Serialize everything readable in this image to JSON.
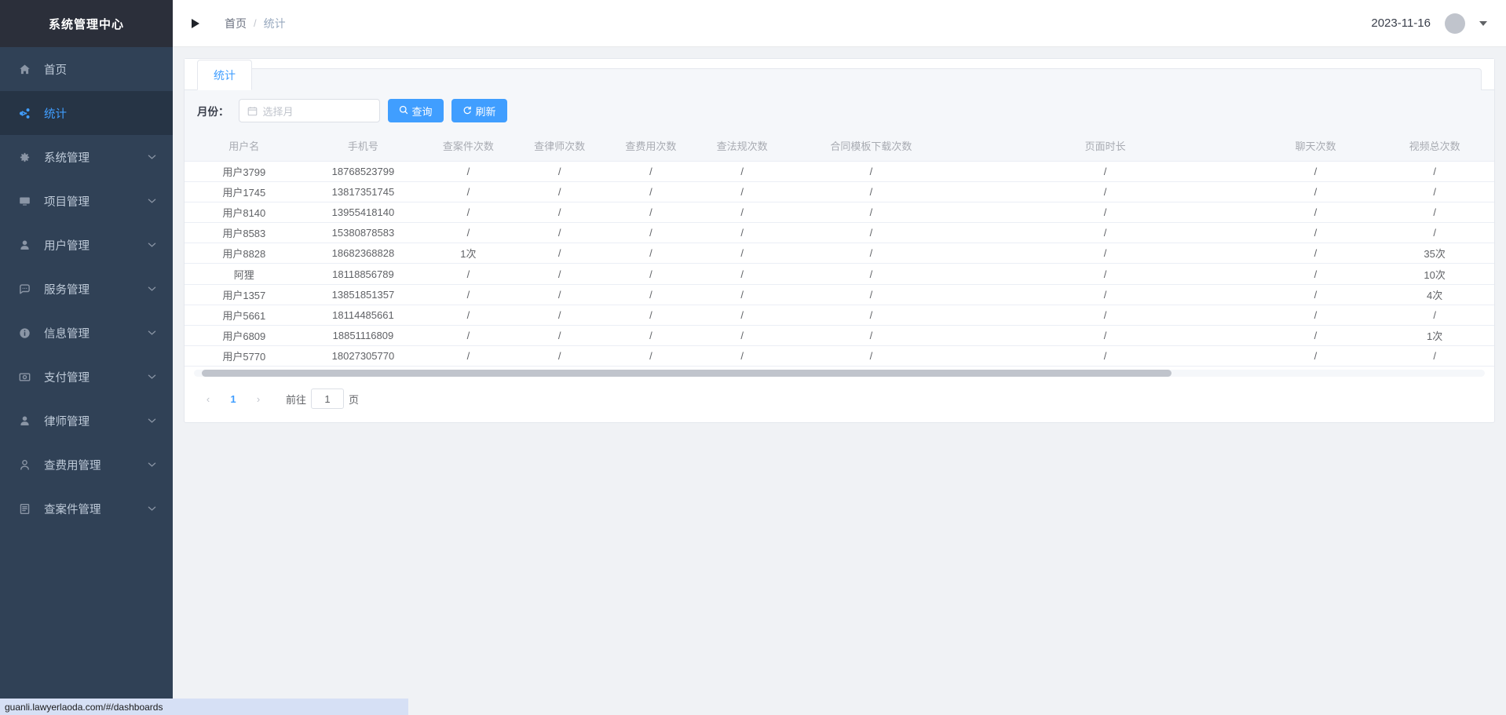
{
  "sidebar": {
    "logo": "系统管理中心",
    "items": [
      {
        "label": "首页",
        "icon": "home-icon",
        "active": false,
        "expandable": false
      },
      {
        "label": "统计",
        "icon": "share-icon",
        "active": true,
        "expandable": false
      },
      {
        "label": "系统管理",
        "icon": "gear-icon",
        "active": false,
        "expandable": true
      },
      {
        "label": "项目管理",
        "icon": "monitor-icon",
        "active": false,
        "expandable": true
      },
      {
        "label": "用户管理",
        "icon": "user-icon",
        "active": false,
        "expandable": true
      },
      {
        "label": "服务管理",
        "icon": "chat-icon",
        "active": false,
        "expandable": true
      },
      {
        "label": "信息管理",
        "icon": "info-icon",
        "active": false,
        "expandable": true
      },
      {
        "label": "支付管理",
        "icon": "payment-icon",
        "active": false,
        "expandable": true
      },
      {
        "label": "律师管理",
        "icon": "user-icon",
        "active": false,
        "expandable": true
      },
      {
        "label": "查费用管理",
        "icon": "person-search-icon",
        "active": false,
        "expandable": true
      },
      {
        "label": "查案件管理",
        "icon": "document-icon",
        "active": false,
        "expandable": true
      }
    ]
  },
  "topbar": {
    "toggle_icon": "collapse-triangle-icon",
    "breadcrumb": {
      "home": "首页",
      "separator": "/",
      "current": "统计"
    },
    "date": "2023-11-16",
    "avatar_icon": "avatar",
    "caret_icon": "chevron-down-icon"
  },
  "tabs": [
    {
      "label": "统计",
      "active": true
    }
  ],
  "filter": {
    "month_label": "月份：",
    "month_value": "",
    "month_placeholder": "选择月",
    "calendar_icon": "calendar-icon",
    "search_button": "查询",
    "search_icon": "search-icon",
    "refresh_button": "刷新",
    "refresh_icon": "refresh-icon"
  },
  "table": {
    "columns": [
      "用户名",
      "手机号",
      "查案件次数",
      "查律师次数",
      "查费用次数",
      "查法规次数",
      "合同模板下载次数",
      "页面时长",
      "聊天次数",
      "视频总次数"
    ],
    "rows": [
      [
        "用户3799",
        "18768523799",
        "/",
        "/",
        "/",
        "/",
        "/",
        "/",
        "/",
        "/"
      ],
      [
        "用户1745",
        "13817351745",
        "/",
        "/",
        "/",
        "/",
        "/",
        "/",
        "/",
        "/"
      ],
      [
        "用户8140",
        "13955418140",
        "/",
        "/",
        "/",
        "/",
        "/",
        "/",
        "/",
        "/"
      ],
      [
        "用户8583",
        "15380878583",
        "/",
        "/",
        "/",
        "/",
        "/",
        "/",
        "/",
        "/"
      ],
      [
        "用户8828",
        "18682368828",
        "1次",
        "/",
        "/",
        "/",
        "/",
        "/",
        "/",
        "35次"
      ],
      [
        "阿狸",
        "18118856789",
        "/",
        "/",
        "/",
        "/",
        "/",
        "/",
        "/",
        "10次"
      ],
      [
        "用户1357",
        "13851851357",
        "/",
        "/",
        "/",
        "/",
        "/",
        "/",
        "/",
        "4次"
      ],
      [
        "用户5661",
        "18114485661",
        "/",
        "/",
        "/",
        "/",
        "/",
        "/",
        "/",
        "/"
      ],
      [
        "用户6809",
        "18851116809",
        "/",
        "/",
        "/",
        "/",
        "/",
        "/",
        "/",
        "1次"
      ],
      [
        "用户5770",
        "18027305770",
        "/",
        "/",
        "/",
        "/",
        "/",
        "/",
        "/",
        "/"
      ]
    ]
  },
  "pagination": {
    "prev_icon": "chevron-left-icon",
    "next_icon": "chevron-right-icon",
    "pages": [
      "1"
    ],
    "current_page": "1",
    "jump_prefix": "前往",
    "jump_value": "1",
    "jump_suffix": "页"
  },
  "statusbar": {
    "url": "guanli.lawyerlaoda.com/#/dashboards"
  },
  "colors": {
    "sidebar_bg": "#304156",
    "sidebar_logo_bg": "#2b2f3a",
    "sidebar_active_bg": "#263445",
    "accent": "#409EFF",
    "page_bg": "#f0f2f5",
    "table_header_bg": "#f5f7fa",
    "status_bg": "#d6e0f5"
  }
}
